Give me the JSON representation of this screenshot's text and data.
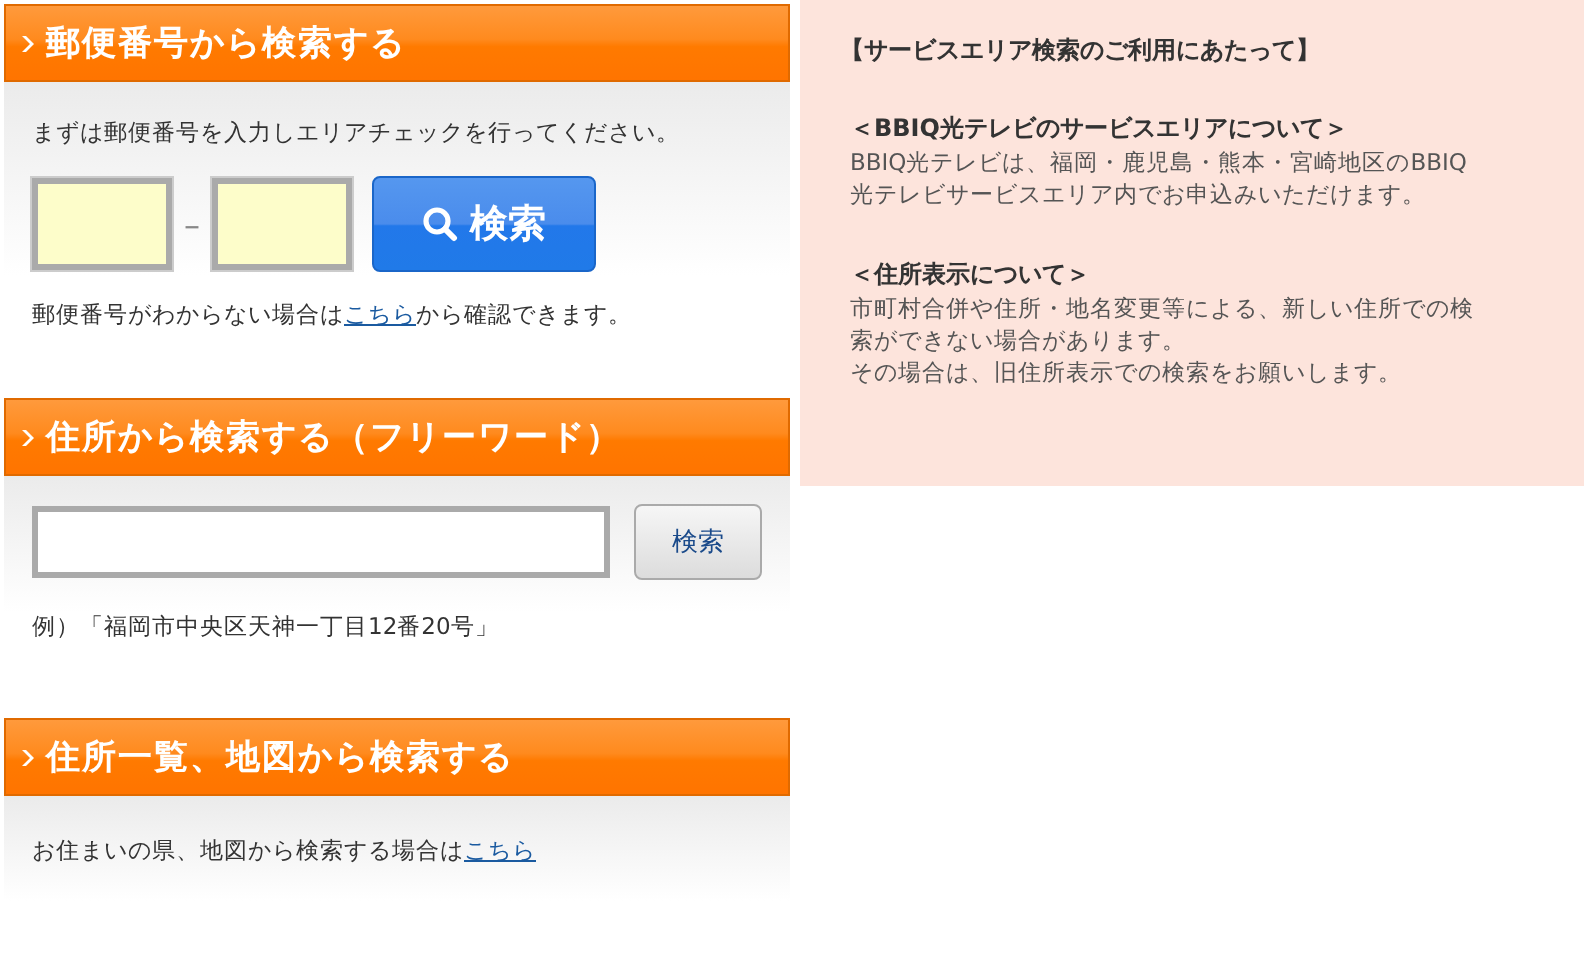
{
  "postal_search": {
    "title": "郵便番号から検索する",
    "instruction": "まずは郵便番号を入力しエリアチェックを行ってください。",
    "separator": "–",
    "button": "検索",
    "note": {
      "before": "郵便番号がわからない場合は",
      "link": "こちら",
      "after": "から確認できます。"
    }
  },
  "address_search": {
    "title": "住所から検索する（フリーワード）",
    "button": "検索",
    "example": "例）「福岡市中央区天神一丁目12番20号」"
  },
  "map_search": {
    "title": "住所一覧、地図から検索する",
    "note": {
      "before": "お住まいの県、地図から検索する場合は",
      "link": "こちら"
    }
  },
  "info_panel": {
    "title": "【サービスエリア検索のご利用にあたって】",
    "sections": [
      {
        "heading": "＜BBIQ光テレビのサービスエリアについて＞",
        "lines": [
          "BBIQ光テレビは、福岡・鹿児島・熊本・宮崎地区のBBIQ",
          "光テレビサービスエリア内でお申込みいただけます。"
        ]
      },
      {
        "heading": "＜住所表示について＞",
        "lines": [
          "市町村合併や住所・地名変更等による、新しい住所での検",
          "索ができない場合があります。",
          "その場合は、旧住所表示での検索をお願いします。"
        ]
      }
    ]
  }
}
